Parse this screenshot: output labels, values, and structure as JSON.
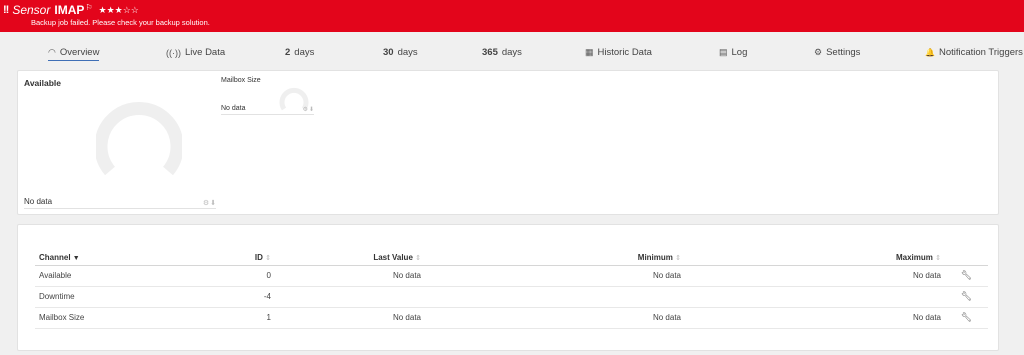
{
  "header": {
    "warning_icon": "!!",
    "sensor_kind": "Sensor",
    "sensor_name": "IMAP",
    "flag_icon": "flag-icon",
    "stars": "★★★☆☆",
    "message": "Backup job failed. Please check your backup solution.",
    "background_color": "#e3051b"
  },
  "tabs": [
    {
      "icon": "gauge-icon",
      "icon_char": "◠",
      "label": "Overview",
      "active": true
    },
    {
      "icon": "live-data-icon",
      "icon_char": "((·))",
      "label": "Live Data"
    },
    {
      "num": "2",
      "label": "days"
    },
    {
      "num": "30",
      "label": "days"
    },
    {
      "num": "365",
      "label": "days"
    },
    {
      "icon": "historic-data-icon",
      "icon_char": "▦",
      "label": "Historic Data"
    },
    {
      "icon": "log-icon",
      "icon_char": "▤",
      "label": "Log"
    },
    {
      "icon": "gear-icon",
      "icon_char": "⚙",
      "label": "Settings"
    },
    {
      "icon": "bell-icon",
      "icon_char": "🔔",
      "label": "Notification Triggers"
    }
  ],
  "gauges": [
    {
      "title": "Available",
      "value": "No data",
      "tool_icons": [
        "gear-icon",
        "download-icon"
      ]
    },
    {
      "title": "Mailbox Size",
      "value": "No data",
      "tool_icons": [
        "gear-icon",
        "download-icon"
      ]
    }
  ],
  "channels": {
    "headers": {
      "channel": "Channel",
      "id": "ID",
      "last_value": "Last Value",
      "minimum": "Minimum",
      "maximum": "Maximum"
    },
    "rows": [
      {
        "channel": "Available",
        "id": "0",
        "last_value": "No data",
        "minimum": "No data",
        "maximum": "No data"
      },
      {
        "channel": "Downtime",
        "id": "-4",
        "last_value": "",
        "minimum": "",
        "maximum": ""
      },
      {
        "channel": "Mailbox Size",
        "id": "1",
        "last_value": "No data",
        "minimum": "No data",
        "maximum": "No data"
      }
    ],
    "row_action_icon": "wrench-icon"
  }
}
